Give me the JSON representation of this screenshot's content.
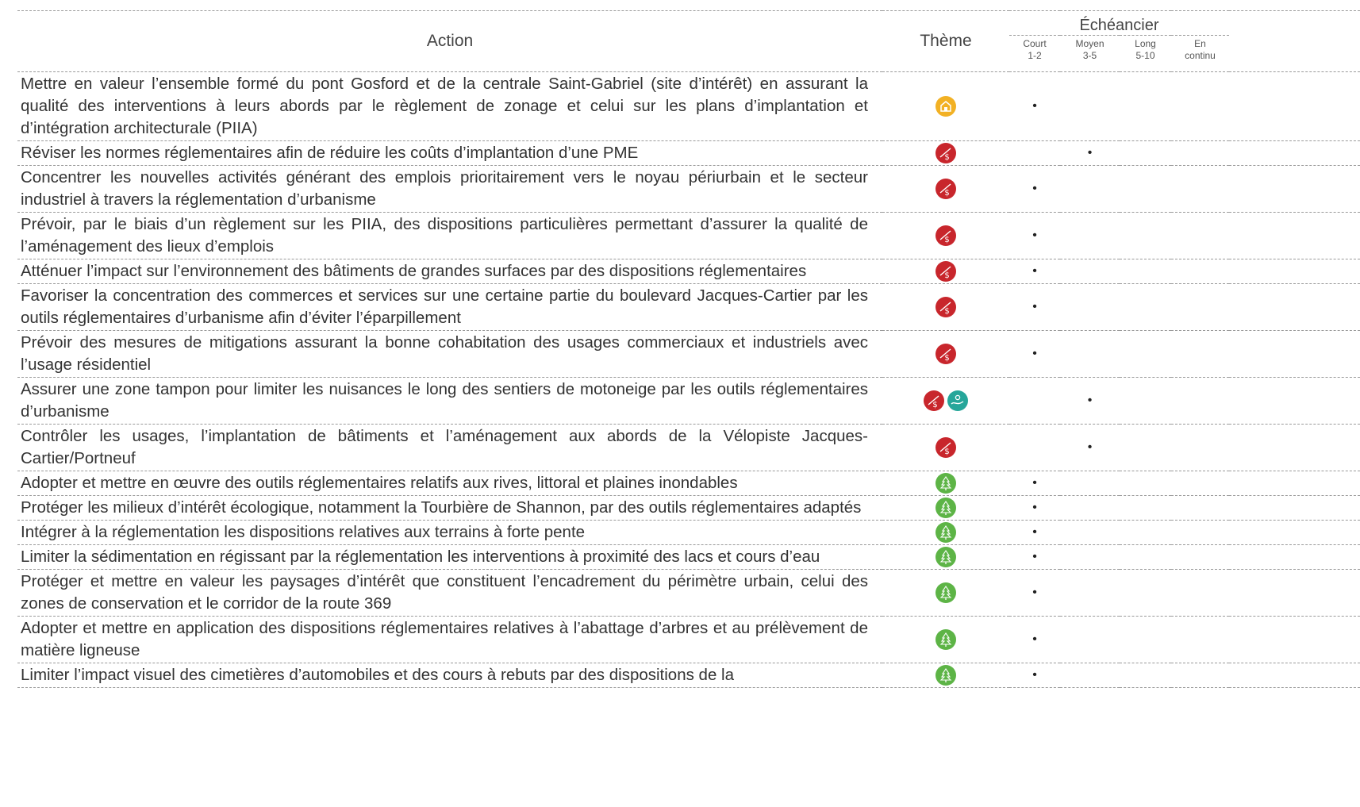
{
  "header": {
    "action": "Action",
    "theme": "Thème",
    "schedule": "Échéancier",
    "court": "Court",
    "court_range": "1-2",
    "moyen": "Moyen",
    "moyen_range": "3-5",
    "long": "Long",
    "long_range": "5-10",
    "en": "En",
    "continu": "continu"
  },
  "colors": {
    "economy_icon": "#c8262c",
    "heritage_icon": "#f2b124",
    "environment_icon": "#5db446",
    "transport_icon": "#26a69a"
  },
  "mark_symbol": "•",
  "rows": [
    {
      "text": "Mettre en valeur l’ensemble formé du pont Gosford et de la centrale Saint-Gabriel (site d’intérêt) en assurant la qualité des interventions à leurs abords par le règlement de zonage et celui sur les plans d’implantation et d’intégration architecturale (PIIA)",
      "themes": [
        "heritage-icon"
      ],
      "schedule": "court"
    },
    {
      "text": "Réviser les normes réglementaires afin de réduire les coûts d’implantation d’une PME",
      "themes": [
        "economy-icon"
      ],
      "schedule": "moyen"
    },
    {
      "text": "Concentrer les nouvelles activités générant des emplois prioritairement vers le noyau périurbain et le secteur industriel à travers la réglementation d’urbanisme",
      "themes": [
        "economy-icon"
      ],
      "schedule": "court"
    },
    {
      "text": "Prévoir, par le biais d’un règlement sur les PIIA, des dispositions particulières permettant d’assurer la qualité de l’aménagement des lieux d’emplois",
      "themes": [
        "economy-icon"
      ],
      "schedule": "court"
    },
    {
      "text": "Atténuer l’impact sur l’environnement des bâtiments de grandes surfaces par des dispositions réglementaires",
      "themes": [
        "economy-icon"
      ],
      "schedule": "court"
    },
    {
      "text": "Favoriser la concentration des commerces et services sur une certaine partie du boulevard Jacques-Cartier par les outils réglementaires d’urbanisme afin d’éviter l’éparpillement",
      "themes": [
        "economy-icon"
      ],
      "schedule": "court"
    },
    {
      "text": "Prévoir des mesures de mitigations assurant la bonne cohabitation des usages commerciaux et industriels avec l’usage résidentiel",
      "themes": [
        "economy-icon"
      ],
      "schedule": "court"
    },
    {
      "text": "Assurer une zone tampon pour limiter les nuisances le long des sentiers de motoneige par les outils réglementaires d’urbanisme",
      "themes": [
        "economy-icon",
        "transport-icon"
      ],
      "schedule": "moyen"
    },
    {
      "text": "Contrôler les usages, l’implantation de bâtiments et l’aménagement aux abords de la Vélopiste Jacques-Cartier/Portneuf",
      "themes": [
        "economy-icon"
      ],
      "schedule": "moyen"
    },
    {
      "text": "Adopter et mettre en œuvre des outils réglementaires relatifs aux rives, littoral et plaines inondables",
      "themes": [
        "environment-icon"
      ],
      "schedule": "court"
    },
    {
      "text": "Protéger les milieux d’intérêt écologique, notamment la Tourbière de Shannon, par des outils réglementaires adaptés",
      "themes": [
        "environment-icon"
      ],
      "schedule": "court"
    },
    {
      "text": "Intégrer à la réglementation les dispositions relatives aux terrains à forte pente",
      "themes": [
        "environment-icon"
      ],
      "schedule": "court"
    },
    {
      "text": "Limiter la sédimentation en régissant par la réglementation les interventions à proximité des lacs et cours d’eau",
      "themes": [
        "environment-icon"
      ],
      "schedule": "court"
    },
    {
      "text": "Protéger et mettre en valeur les paysages d’intérêt que constituent l’encadrement du périmètre urbain, celui des zones de conservation et le corridor de la route 369",
      "themes": [
        "environment-icon"
      ],
      "schedule": "court"
    },
    {
      "text": "Adopter et mettre en application des dispositions réglementaires relatives à l’abattage d’arbres et au prélèvement de matière ligneuse",
      "themes": [
        "environment-icon"
      ],
      "schedule": "court"
    },
    {
      "text": "Limiter l’impact visuel des cimetières d’automobiles et des cours à rebuts par des dispositions de la",
      "themes": [
        "environment-icon"
      ],
      "schedule": "court"
    }
  ]
}
